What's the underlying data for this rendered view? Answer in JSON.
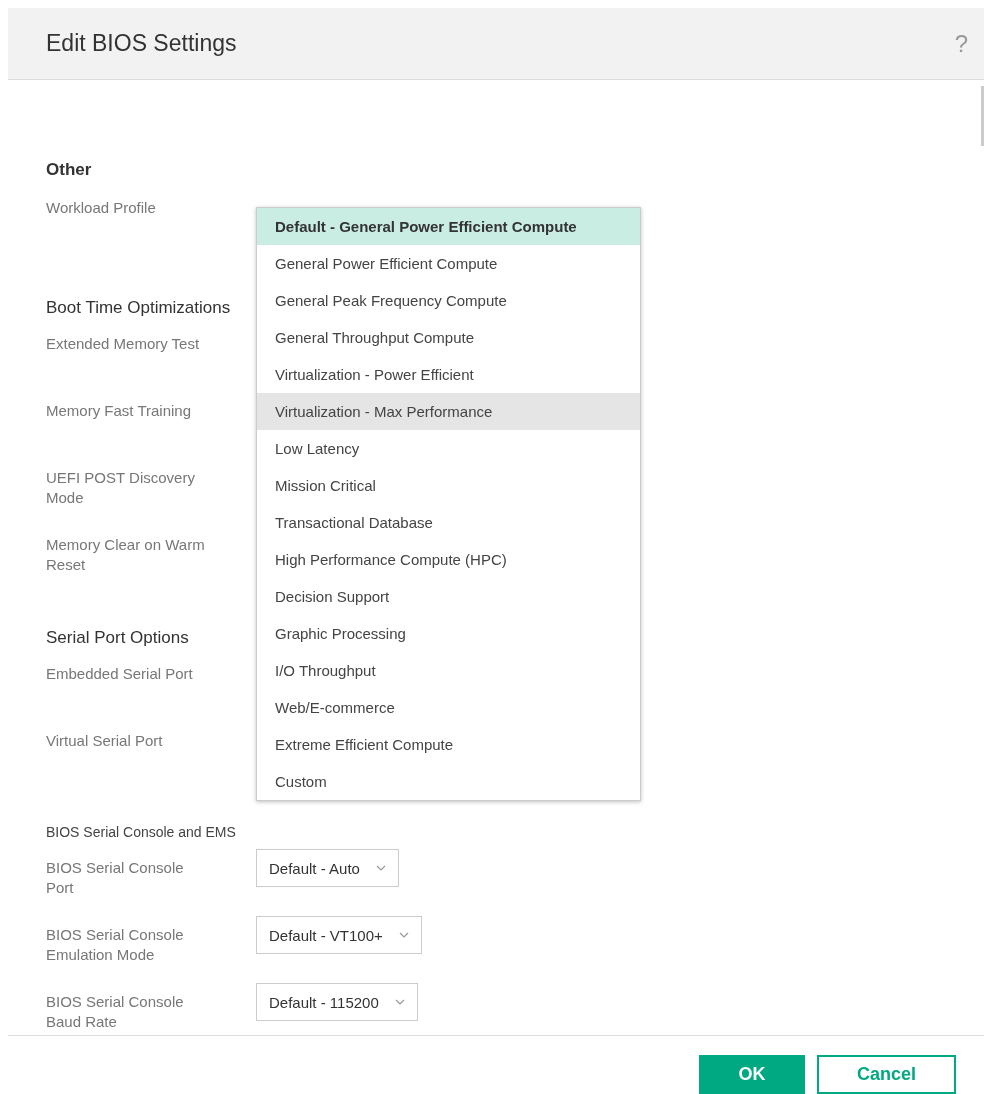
{
  "dialog": {
    "title": "Edit BIOS Settings",
    "help": "?"
  },
  "sections": [
    {
      "title": "Other",
      "kind": "bold",
      "fields": [
        {
          "label": "Workload Profile",
          "dropdown": true
        }
      ]
    },
    {
      "title": "Boot Time Optimizations",
      "kind": "normal",
      "fields": [
        {
          "label": "Extended Memory Test"
        },
        {
          "label": "Memory Fast Training"
        },
        {
          "label": "UEFI POST Discovery Mode"
        },
        {
          "label": "Memory Clear on Warm Reset"
        }
      ]
    },
    {
      "title": "Serial Port Options",
      "kind": "normal",
      "fields": [
        {
          "label": "Embedded Serial Port"
        },
        {
          "label": "Virtual Serial Port"
        }
      ]
    },
    {
      "title": "BIOS Serial Console and EMS",
      "kind": "small",
      "fields": [
        {
          "label": "BIOS Serial Console Port",
          "value": "Default - Auto"
        },
        {
          "label": "BIOS Serial Console Emulation Mode",
          "value": "Default - VT100+"
        },
        {
          "label": "BIOS Serial Console Baud Rate",
          "value": "Default - 115200"
        }
      ]
    }
  ],
  "dropdown_options": [
    {
      "label": "Default - General Power Efficient Compute",
      "selected": true,
      "highlighted": false
    },
    {
      "label": "General Power Efficient Compute",
      "selected": false,
      "highlighted": false
    },
    {
      "label": "General Peak Frequency Compute",
      "selected": false,
      "highlighted": false
    },
    {
      "label": "General Throughput Compute",
      "selected": false,
      "highlighted": false
    },
    {
      "label": "Virtualization - Power Efficient",
      "selected": false,
      "highlighted": false
    },
    {
      "label": "Virtualization - Max Performance",
      "selected": false,
      "highlighted": true
    },
    {
      "label": "Low Latency",
      "selected": false,
      "highlighted": false
    },
    {
      "label": "Mission Critical",
      "selected": false,
      "highlighted": false
    },
    {
      "label": "Transactional Database",
      "selected": false,
      "highlighted": false
    },
    {
      "label": "High Performance Compute (HPC)",
      "selected": false,
      "highlighted": false
    },
    {
      "label": "Decision Support",
      "selected": false,
      "highlighted": false
    },
    {
      "label": "Graphic Processing",
      "selected": false,
      "highlighted": false
    },
    {
      "label": "I/O Throughput",
      "selected": false,
      "highlighted": false
    },
    {
      "label": "Web/E-commerce",
      "selected": false,
      "highlighted": false
    },
    {
      "label": "Extreme Efficient Compute",
      "selected": false,
      "highlighted": false
    },
    {
      "label": "Custom",
      "selected": false,
      "highlighted": false
    }
  ],
  "buttons": [
    {
      "label": "OK",
      "kind": "primary"
    },
    {
      "label": "Cancel",
      "kind": "secondary"
    }
  ]
}
